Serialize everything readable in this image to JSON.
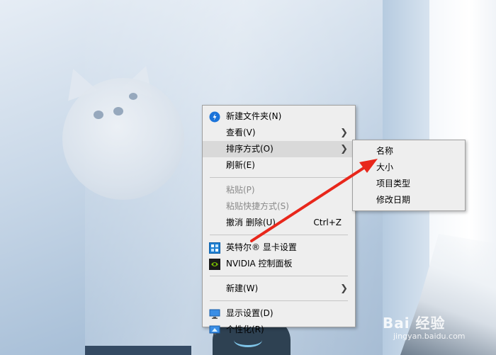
{
  "context_menu": {
    "items": [
      {
        "label": "新建文件夹(N)"
      },
      {
        "label": "查看(V)"
      },
      {
        "label": "排序方式(O)"
      },
      {
        "label": "刷新(E)"
      },
      {
        "label": "粘贴(P)"
      },
      {
        "label": "粘贴快捷方式(S)"
      },
      {
        "label": "撤消 删除(U)",
        "shortcut": "Ctrl+Z"
      },
      {
        "label": "英特尔® 显卡设置"
      },
      {
        "label": "NVIDIA 控制面板"
      },
      {
        "label": "新建(W)"
      },
      {
        "label": "显示设置(D)"
      },
      {
        "label": "个性化(R)"
      }
    ]
  },
  "sort_submenu": {
    "items": [
      {
        "label": "名称"
      },
      {
        "label": "大小"
      },
      {
        "label": "项目类型"
      },
      {
        "label": "修改日期"
      }
    ]
  },
  "watermark": {
    "text": "Bai 经验",
    "sub": "jingyan.baidu.com"
  },
  "colors": {
    "menu_bg": "#eeeeee",
    "hover_bg": "#d9d9d9",
    "annotation_arrow": "#e8271b"
  }
}
